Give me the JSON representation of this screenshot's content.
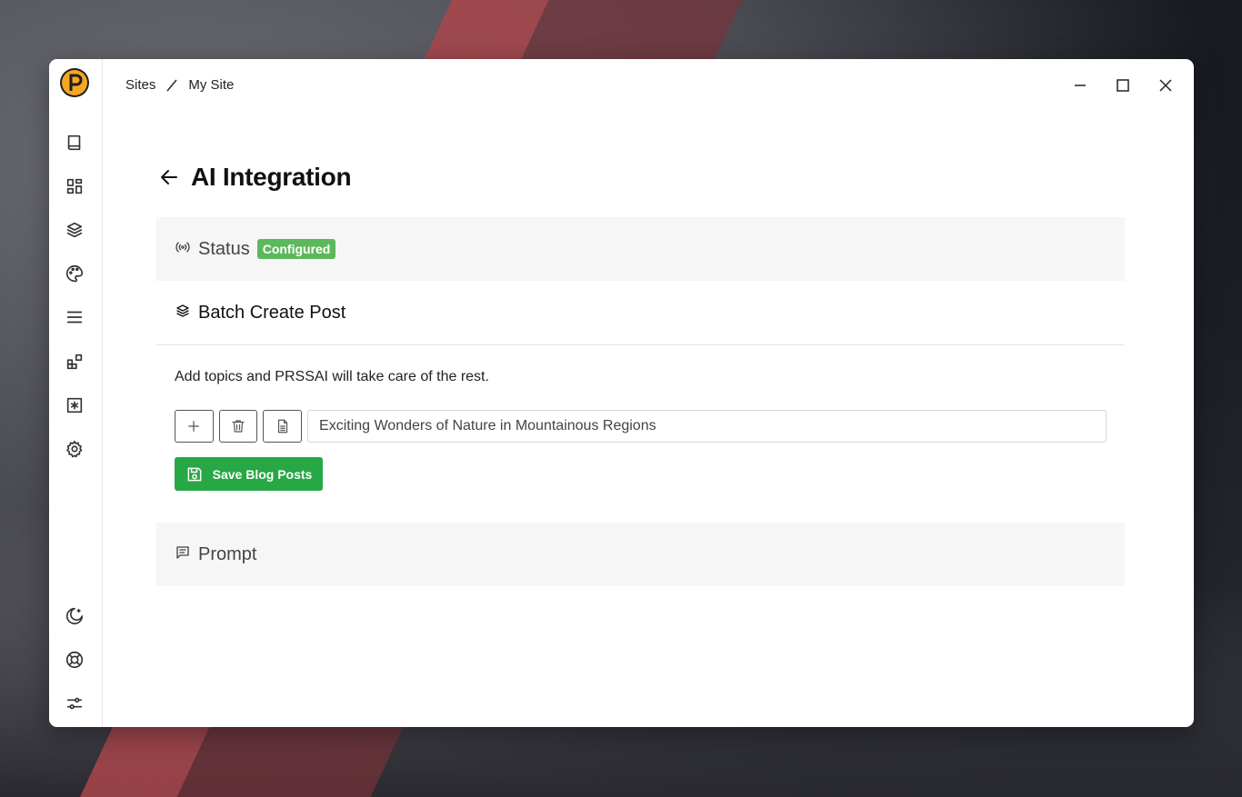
{
  "breadcrumb": {
    "root": "Sites",
    "current": "My Site"
  },
  "page": {
    "title": "AI Integration"
  },
  "status": {
    "label": "Status",
    "badge": "Configured",
    "badge_color": "#5cb85c"
  },
  "batch": {
    "title": "Batch Create Post",
    "description": "Add topics and PRSSAI will take care of the rest.",
    "topic_value": "Exciting Wonders of Nature in Mountainous Regions",
    "save_label": "Save Blog Posts",
    "save_color": "#28a745"
  },
  "prompt": {
    "label": "Prompt"
  },
  "sidebar": {
    "top_icons": [
      "book-icon",
      "dashboard-icon",
      "layers-icon",
      "palette-icon",
      "menu-icon",
      "widgets-icon",
      "asterisk-box-icon",
      "gear-icon"
    ],
    "bottom_icons": [
      "moon-icon",
      "lifebuoy-icon",
      "sliders-icon"
    ]
  }
}
